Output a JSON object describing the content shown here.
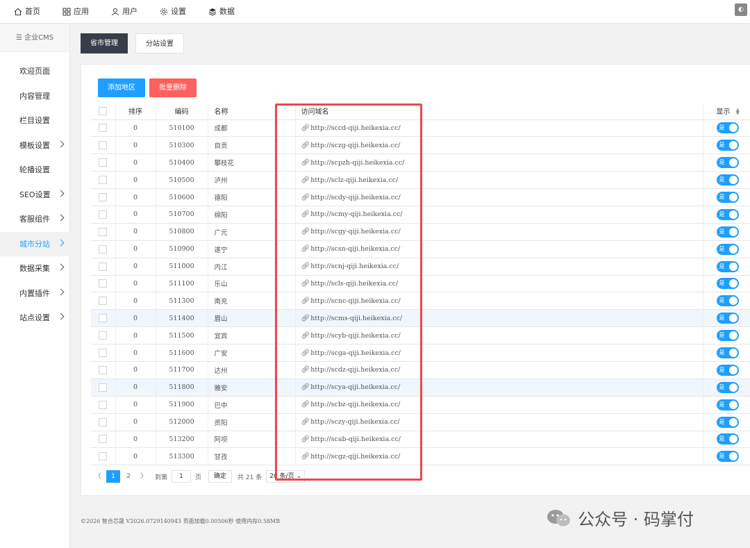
{
  "topnav": [
    {
      "label": "首页",
      "icon": "home-icon"
    },
    {
      "label": "应用",
      "icon": "apps-icon"
    },
    {
      "label": "用户",
      "icon": "user-icon"
    },
    {
      "label": "设置",
      "icon": "gear-icon"
    },
    {
      "label": "数据",
      "icon": "database-icon"
    }
  ],
  "sidebar": {
    "brand": "☰ 企业CMS",
    "items": [
      {
        "label": "欢迎页面",
        "has_sub": false,
        "active": false
      },
      {
        "label": "内容管理",
        "has_sub": false,
        "active": false
      },
      {
        "label": "栏目设置",
        "has_sub": false,
        "active": false
      },
      {
        "label": "模板设置",
        "has_sub": true,
        "active": false
      },
      {
        "label": "轮播设置",
        "has_sub": false,
        "active": false
      },
      {
        "label": "SEO设置",
        "has_sub": true,
        "active": false
      },
      {
        "label": "客服组件",
        "has_sub": true,
        "active": false
      },
      {
        "label": "城市分站",
        "has_sub": true,
        "active": true
      },
      {
        "label": "数据采集",
        "has_sub": true,
        "active": false
      },
      {
        "label": "内置插件",
        "has_sub": true,
        "active": false
      },
      {
        "label": "站点设置",
        "has_sub": true,
        "active": false
      }
    ]
  },
  "tabs": {
    "province": "省市管理",
    "substation": "分站设置"
  },
  "buttons": {
    "add": "添加地区",
    "batch_delete": "批量删除"
  },
  "table": {
    "headers": {
      "sort": "排序",
      "code": "编码",
      "name": "名称",
      "url": "访问域名",
      "show": "显示"
    },
    "switch_label": "是",
    "rows": [
      {
        "sort": "0",
        "code": "510100",
        "name": "成都",
        "url": "http://sccd-qiji.heikexia.cc/"
      },
      {
        "sort": "0",
        "code": "510300",
        "name": "自贡",
        "url": "http://sczg-qiji.heikexia.cc/"
      },
      {
        "sort": "0",
        "code": "510400",
        "name": "攀枝花",
        "url": "http://scpzh-qiji.heikexia.cc/"
      },
      {
        "sort": "0",
        "code": "510500",
        "name": "泸州",
        "url": "http://sclz-qiji.heikexia.cc/"
      },
      {
        "sort": "0",
        "code": "510600",
        "name": "德阳",
        "url": "http://scdy-qiji.heikexia.cc/"
      },
      {
        "sort": "0",
        "code": "510700",
        "name": "绵阳",
        "url": "http://scmy-qiji.heikexia.cc/"
      },
      {
        "sort": "0",
        "code": "510800",
        "name": "广元",
        "url": "http://scgy-qiji.heikexia.cc/"
      },
      {
        "sort": "0",
        "code": "510900",
        "name": "遂宁",
        "url": "http://scsn-qiji.heikexia.cc/"
      },
      {
        "sort": "0",
        "code": "511000",
        "name": "内江",
        "url": "http://scnj-qiji.heikexia.cc/"
      },
      {
        "sort": "0",
        "code": "511100",
        "name": "乐山",
        "url": "http://scls-qiji.heikexia.cc/"
      },
      {
        "sort": "0",
        "code": "511300",
        "name": "南充",
        "url": "http://scnc-qiji.heikexia.cc/"
      },
      {
        "sort": "0",
        "code": "511400",
        "name": "眉山",
        "url": "http://scms-qiji.heikexia.cc/",
        "hl": true
      },
      {
        "sort": "0",
        "code": "511500",
        "name": "宜宾",
        "url": "http://scyb-qiji.heikexia.cc/"
      },
      {
        "sort": "0",
        "code": "511600",
        "name": "广安",
        "url": "http://scga-qiji.heikexia.cc/"
      },
      {
        "sort": "0",
        "code": "511700",
        "name": "达州",
        "url": "http://scdz-qiji.heikexia.cc/"
      },
      {
        "sort": "0",
        "code": "511800",
        "name": "雅安",
        "url": "http://scya-qiji.heikexia.cc/",
        "hl": true
      },
      {
        "sort": "0",
        "code": "511900",
        "name": "巴中",
        "url": "http://scbz-qiji.heikexia.cc/"
      },
      {
        "sort": "0",
        "code": "512000",
        "name": "资阳",
        "url": "http://sczy-qiji.heikexia.cc/"
      },
      {
        "sort": "0",
        "code": "513200",
        "name": "阿坝",
        "url": "http://scab-qiji.heikexia.cc/"
      },
      {
        "sort": "0",
        "code": "513300",
        "name": "甘孜",
        "url": "http://scgz-qiji.heikexia.cc/"
      }
    ]
  },
  "pager": {
    "prev": "〈",
    "page1": "1",
    "page2": "2",
    "next": "〉",
    "goto_prefix": "到第",
    "goto_value": "1",
    "goto_suffix": "页",
    "confirm": "确定",
    "total": "共 21 条",
    "page_size": "20 条/页"
  },
  "footer": "©2026 智合芯晟 V2026.0729140943 页面加载0.00506秒 使用内存0.58MB",
  "watermark": "公众号 · 码掌付",
  "colors": {
    "accent": "#1e9fff",
    "danger": "#ff5f5f",
    "dark_tab": "#393d49",
    "highlight_box": "#e9484d"
  }
}
